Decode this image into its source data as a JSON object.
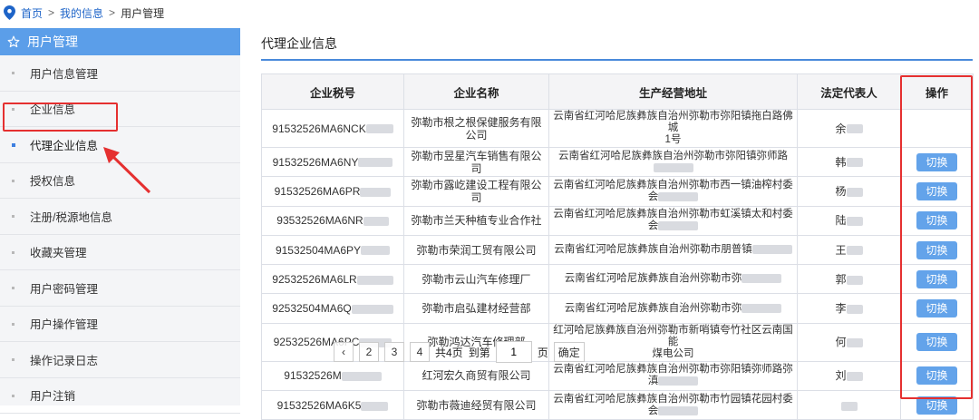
{
  "breadcrumb": {
    "home": "首页",
    "sep": ">",
    "mid": "我的信息",
    "current": "用户管理"
  },
  "sidebar": {
    "title": "用户管理",
    "items": [
      {
        "label": "用户信息管理"
      },
      {
        "label": "企业信息"
      },
      {
        "label": "代理企业信息"
      },
      {
        "label": "授权信息"
      },
      {
        "label": "注册/税源地信息"
      },
      {
        "label": "收藏夹管理"
      },
      {
        "label": "用户密码管理"
      },
      {
        "label": "用户操作管理"
      },
      {
        "label": "操作记录日志"
      },
      {
        "label": "用户注销"
      }
    ]
  },
  "panel": {
    "title": "代理企业信息"
  },
  "table": {
    "headers": [
      "企业税号",
      "企业名称",
      "生产经营地址",
      "法定代表人",
      "操作"
    ],
    "rows": [
      {
        "tax": "91532526MA6NCK",
        "name": "弥勒市根之根保健服务有限公司",
        "addr": "云南省红河哈尼族彝族自治州弥勒市弥阳镇拖白路佛城",
        "addr2": "1号",
        "rep": "余",
        "action": ""
      },
      {
        "tax": "91532526MA6NY",
        "name": "弥勒市昱星汽车销售有限公司",
        "addr": "云南省红河哈尼族彝族自治州弥勒市弥阳镇弥师路",
        "addr2": "",
        "rep": "韩",
        "action": "切换"
      },
      {
        "tax": "91532526MA6PR",
        "name": "弥勒市露屹建设工程有限公司",
        "addr": "云南省红河哈尼族彝族自治州弥勒市西一镇油榨村委会",
        "addr2": "",
        "rep": "杨",
        "action": "切换"
      },
      {
        "tax": "93532526MA6NR",
        "name": "弥勒市兰天种植专业合作社",
        "addr": "云南省红河哈尼族彝族自治州弥勒市虹溪镇太和村委会",
        "addr2": "",
        "rep": "陆",
        "action": "切换"
      },
      {
        "tax": "91532504MA6PY",
        "name": "弥勒市荣润工贸有限公司",
        "addr": "云南省红河哈尼族彝族自治州弥勒市朋普镇",
        "addr2": "",
        "rep": "王",
        "action": "切换"
      },
      {
        "tax": "92532526MA6LR",
        "name": "弥勒市云山汽车修理厂",
        "addr": "云南省红河哈尼族彝族自治州弥勒市弥",
        "addr2": "",
        "rep": "郭",
        "action": "切换"
      },
      {
        "tax": "92532504MA6Q",
        "name": "弥勒市启弘建材经营部",
        "addr": "云南省红河哈尼族彝族自治州弥勒市弥",
        "addr2": "",
        "rep": "李",
        "action": "切换"
      },
      {
        "tax": "92532526MA6PC",
        "name": "弥勒鸿达汽车修理部",
        "addr": "红河哈尼族彝族自治州弥勒市新哨镇夸竹社区云南国能",
        "addr2": "煤电公司",
        "rep": "何",
        "action": "切换"
      },
      {
        "tax": "91532526M",
        "name": "红河宏久商贸有限公司",
        "addr": "云南省红河哈尼族彝族自治州弥勒市弥阳镇弥师路弥滇",
        "addr2": "",
        "rep": "刘",
        "action": "切换"
      },
      {
        "tax": "91532526MA6K5",
        "name": "弥勒市薇迪经贸有限公司",
        "addr": "云南省红河哈尼族彝族自治州弥勒市竹园镇花园村委会",
        "addr2": "",
        "rep": "",
        "action": "切换"
      }
    ]
  },
  "pager": {
    "p2": "2",
    "p3": "3",
    "p4": "4",
    "total": "共4页",
    "goto": "到第",
    "input": "1",
    "page_unit": "页",
    "confirm": "确定"
  },
  "colors": {
    "accent": "#5b9ee9",
    "button": "#63a3ea",
    "highlight": "#e53030"
  }
}
